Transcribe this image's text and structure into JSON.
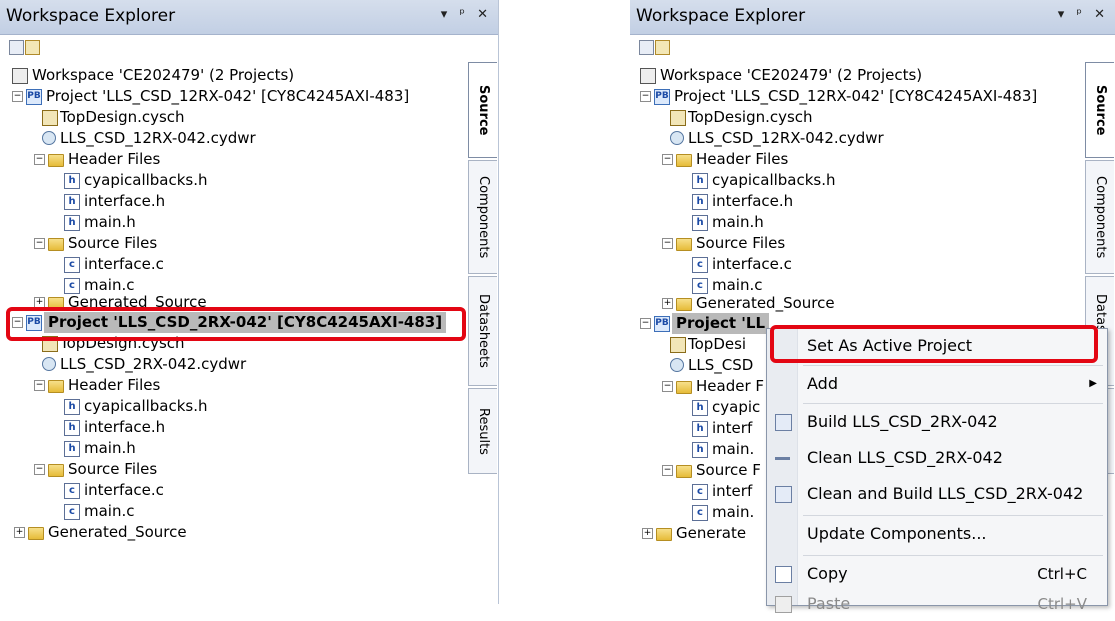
{
  "panel": {
    "title": "Workspace Explorer",
    "title_buttons": "▾ ᵖ ✕"
  },
  "tabs": [
    "Source",
    "Components",
    "Datasheets",
    "Results"
  ],
  "tree": {
    "workspace": "Workspace 'CE202479' (2 Projects)",
    "project1": "Project  'LLS_CSD_12RX-042' [CY8C4245AXI-483]",
    "project1_children": {
      "topdesign": "TopDesign.cysch",
      "cydwr": "LLS_CSD_12RX-042.cydwr",
      "header_files": "Header Files",
      "headers": [
        "cyapicallbacks.h",
        "interface.h",
        "main.h"
      ],
      "source_files": "Source Files",
      "sources": [
        "interface.c",
        "main.c"
      ],
      "generated": "Generated_Source"
    },
    "project2": "Project  'LLS_CSD_2RX-042' [CY8C4245AXI-483]",
    "project2_children": {
      "topdesign": "TopDesign.cysch",
      "cydwr": "LLS_CSD_2RX-042.cydwr",
      "header_files": "Header Files",
      "headers": [
        "cyapicallbacks.h",
        "interface.h",
        "main.h"
      ],
      "source_files": "Source Files",
      "sources": [
        "interface.c",
        "main.c"
      ],
      "generated": "Generated_Source"
    }
  },
  "right_tree_truncated": {
    "project2": "Project  'LL",
    "topdesign": "TopDesi",
    "cydwr": "LLS_CSD",
    "header_files": "Header F",
    "headers": [
      "cyapic",
      "interf",
      "main."
    ],
    "source_files": "Source F",
    "sources": [
      "interf",
      "main."
    ],
    "generated": "Generate"
  },
  "context_menu": {
    "items": [
      {
        "label": "Set As Active Project",
        "shortcut": ""
      },
      {
        "label": "Add",
        "shortcut": ""
      },
      {
        "label": "Build LLS_CSD_2RX-042",
        "shortcut": ""
      },
      {
        "label": "Clean LLS_CSD_2RX-042",
        "shortcut": ""
      },
      {
        "label": "Clean and Build LLS_CSD_2RX-042",
        "shortcut": ""
      },
      {
        "label": "Update Components...",
        "shortcut": ""
      },
      {
        "label": "Copy",
        "shortcut": "Ctrl+C"
      },
      {
        "label": "Paste",
        "shortcut": "Ctrl+V"
      }
    ]
  },
  "colors": {
    "highlight_red": "#e30613",
    "selected_row": "#b9b9b9",
    "titlebar": "#c9d4e6"
  }
}
